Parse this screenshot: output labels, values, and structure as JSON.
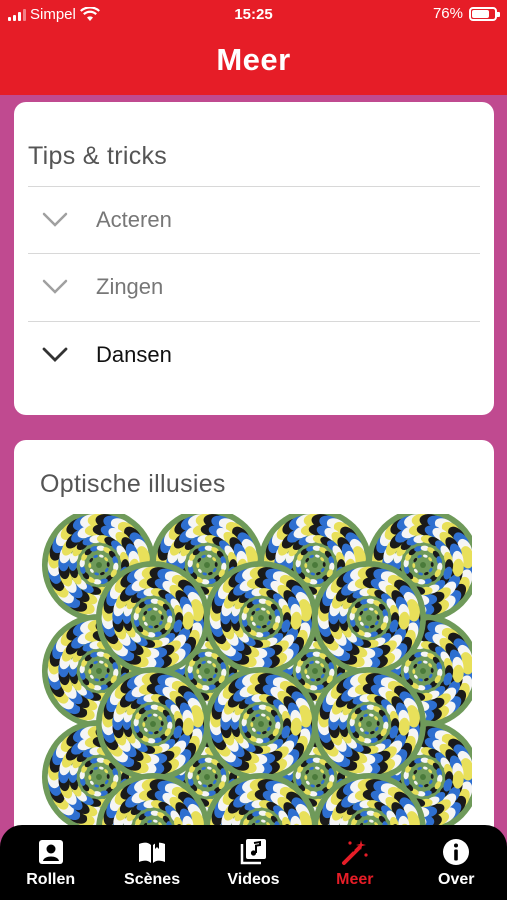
{
  "status": {
    "carrier": "Simpel",
    "time": "15:25",
    "battery": "76%",
    "battery_level": 0.76
  },
  "header": {
    "title": "Meer"
  },
  "tips": {
    "title": "Tips & tricks",
    "items": [
      {
        "label": "Acteren",
        "active": false
      },
      {
        "label": "Zingen",
        "active": false
      },
      {
        "label": "Dansen",
        "active": true
      }
    ]
  },
  "illusions": {
    "title": "Optische illusies"
  },
  "tabs": [
    {
      "label": "Rollen",
      "icon": "person-badge-icon",
      "active": false
    },
    {
      "label": "Scènes",
      "icon": "book-icon",
      "active": false
    },
    {
      "label": "Videos",
      "icon": "music-stack-icon",
      "active": false
    },
    {
      "label": "Meer",
      "icon": "magic-wand-icon",
      "active": true
    },
    {
      "label": "Over",
      "icon": "info-icon",
      "active": false
    }
  ],
  "colors": {
    "header": "#e61d27",
    "background": "#c04a90",
    "accent": "#e61d27",
    "tabbar": "#000000"
  }
}
